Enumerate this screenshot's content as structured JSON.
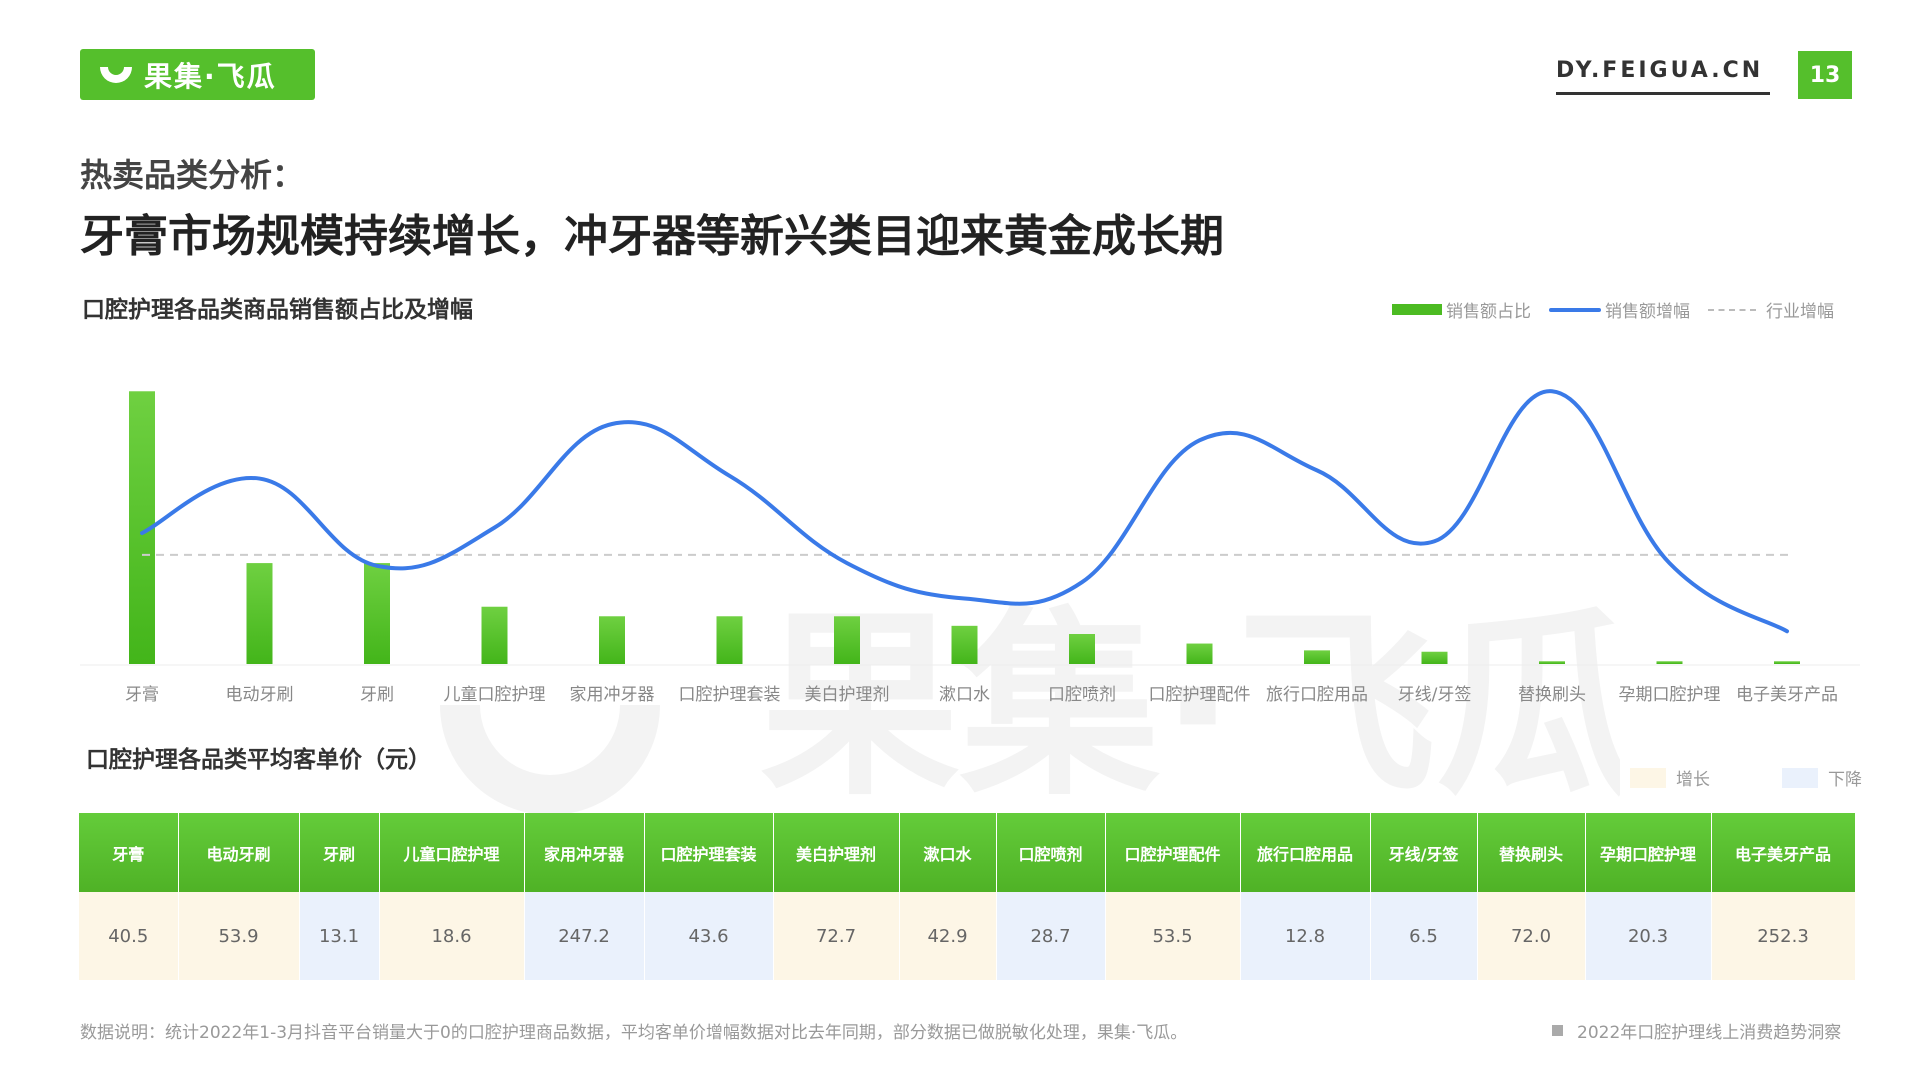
{
  "brand": {
    "name": "果集·飞瓜",
    "site": "DY.FEIGUA.CN",
    "page": "13"
  },
  "heading": {
    "kicker": "热卖品类分析：",
    "title": "牙膏市场规模持续增长，冲牙器等新兴类目迎来黄金成长期"
  },
  "chart_section_title": "口腔护理各品类商品销售额占比及增幅",
  "legend": {
    "bar": "销售额占比",
    "line": "销售额增幅",
    "dashed": "行业增幅"
  },
  "colors": {
    "bar": "#4cbb22",
    "line": "#3a7ae8",
    "dashed": "#cccccc",
    "increase": "#fdf6e6",
    "decrease": "#eaf1fc"
  },
  "chart_data": {
    "type": "bar+line",
    "categories": [
      "牙膏",
      "电动牙刷",
      "牙刷",
      "儿童口腔护理",
      "家用冲牙器",
      "口腔护理套装",
      "美白护理剂",
      "漱口水",
      "口腔喷剂",
      "口腔护理配件",
      "旅行口腔用品",
      "牙线/牙签",
      "替换刷头",
      "孕期口腔护理",
      "电子美牙产品"
    ],
    "series": [
      {
        "name": "销售额占比",
        "kind": "bar",
        "values": [
          100,
          37,
          37,
          21,
          17.5,
          17.5,
          17.5,
          14,
          11,
          7.5,
          5,
          4.5,
          1,
          1,
          1
        ]
      },
      {
        "name": "销售额增幅",
        "kind": "line",
        "values": [
          48,
          68,
          36,
          50,
          88,
          69,
          37,
          24,
          30,
          82,
          71,
          45,
          100,
          37,
          12
        ]
      },
      {
        "name": "行业增幅",
        "kind": "reference",
        "value": 40
      }
    ],
    "ylim": [
      0,
      110
    ],
    "grid": false,
    "legend_position": "top-right"
  },
  "table_section_title": "口腔护理各品类平均客单价（元）",
  "table_legend": {
    "increase": "增长",
    "decrease": "下降"
  },
  "table": {
    "headers": [
      "牙膏",
      "电动牙刷",
      "牙刷",
      "儿童口腔护理",
      "家用冲牙器",
      "口腔护理套装",
      "美白护理剂",
      "漱口水",
      "口腔喷剂",
      "口腔护理配件",
      "旅行口腔用品",
      "牙线/牙签",
      "替换刷头",
      "孕期口腔护理",
      "电子美牙产品"
    ],
    "values": [
      "40.5",
      "53.9",
      "13.1",
      "18.6",
      "247.2",
      "43.6",
      "72.7",
      "42.9",
      "28.7",
      "53.5",
      "12.8",
      "6.5",
      "72.0",
      "20.3",
      "252.3"
    ],
    "trend": [
      "up",
      "up",
      "down",
      "up",
      "down",
      "down",
      "up",
      "up",
      "down",
      "up",
      "down",
      "down",
      "up",
      "down",
      "up"
    ]
  },
  "footnote": "数据说明：统计2022年1-3月抖音平台销量大于0的口腔护理商品数据，平均客单价增幅数据对比去年同期，部分数据已做脱敏化处理，果集·飞瓜。",
  "report_name": "2022年口腔护理线上消费趋势洞察"
}
